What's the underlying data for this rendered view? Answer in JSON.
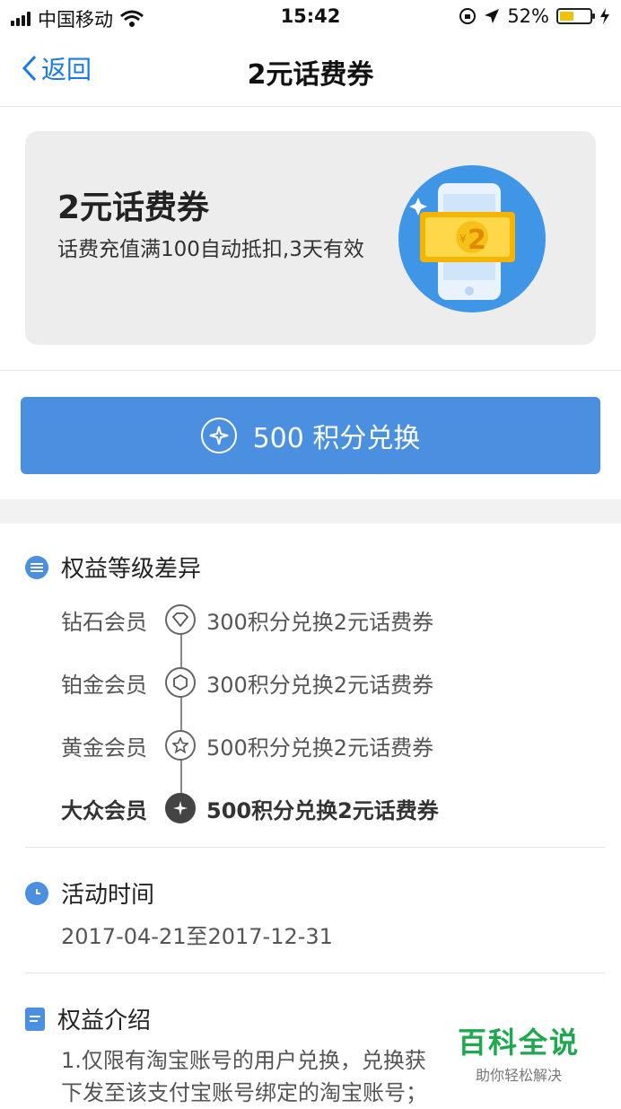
{
  "status_bar": {
    "carrier": "中国移动",
    "time": "15:42",
    "battery": "52%",
    "battery_level": 0.52
  },
  "nav": {
    "back_label": "返回",
    "title": "2元话费券"
  },
  "coupon": {
    "title": "2元话费券",
    "description": "话费充值满100自动抵扣,3天有效",
    "art_value": "2",
    "art_currency": "¥"
  },
  "redeem_button": {
    "label": "500 积分兑换"
  },
  "tiers_section": {
    "heading": "权益等级差异",
    "tiers": [
      {
        "name": "钻石会员",
        "benefit": "300积分兑换2元话费券",
        "icon": "diamond-icon"
      },
      {
        "name": "铂金会员",
        "benefit": "300积分兑换2元话费券",
        "icon": "hexagon-icon"
      },
      {
        "name": "黄金会员",
        "benefit": "500积分兑换2元话费券",
        "icon": "star-icon"
      },
      {
        "name": "大众会员",
        "benefit": "500积分兑换2元话费券",
        "icon": "sparkle-icon"
      }
    ]
  },
  "time_section": {
    "heading": "活动时间",
    "range": "2017-04-21至2017-12-31"
  },
  "intro_section": {
    "heading": "权益介绍",
    "lines": [
      "1.仅限有淘宝账号的用户兑换，兑换获",
      "下发至该支付宝账号绑定的淘宝账号；"
    ]
  },
  "watermark": {
    "brand": "百科全说",
    "tagline": "助你轻松解决"
  },
  "colors": {
    "accent": "#4a8fe0",
    "link": "#1a7be8",
    "card_bg": "#ededed",
    "watermark_green": "#1fa84f"
  }
}
